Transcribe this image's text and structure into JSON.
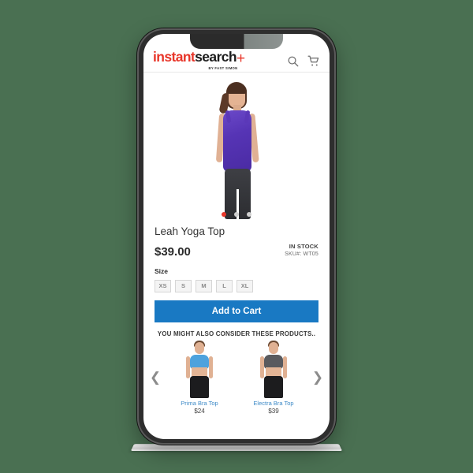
{
  "background_color": "#4a7052",
  "device": {
    "name": "smartphone-mockup",
    "frame_color": "#2e2e2e"
  },
  "header": {
    "logo": {
      "part_red": "instant",
      "part_black": "search",
      "plus": "+",
      "subtitle": "BY FAST SIMON"
    },
    "icons": [
      {
        "name": "search-icon",
        "label": "Search"
      },
      {
        "name": "cart-icon",
        "label": "Cart"
      }
    ]
  },
  "gallery": {
    "image_alt": "Woman wearing purple Leah Yoga Top",
    "dots": [
      {
        "active": true
      },
      {
        "active": false
      },
      {
        "active": false
      }
    ]
  },
  "product": {
    "title": "Leah Yoga Top",
    "price": "$39.00",
    "availability": "IN STOCK",
    "sku": "SKU#:  WT05",
    "accent_color": "#1979c3"
  },
  "size": {
    "label": "Size",
    "options": [
      {
        "label": "XS"
      },
      {
        "label": "S"
      },
      {
        "label": "M"
      },
      {
        "label": "L"
      },
      {
        "label": "XL"
      }
    ]
  },
  "actions": {
    "add_to_cart": "Add to Cart"
  },
  "recommendations": {
    "heading": "YOU MIGHT ALSO CONSIDER THESE PRODUCTS..",
    "prev_arrow": "❮",
    "next_arrow": "❯",
    "items": [
      {
        "name": "Prima Bra Top",
        "price": "$24",
        "bra_color": "#4da2dd"
      },
      {
        "name": "Electra Bra Top",
        "price": "$39",
        "bra_color": "#595a5e"
      }
    ]
  }
}
